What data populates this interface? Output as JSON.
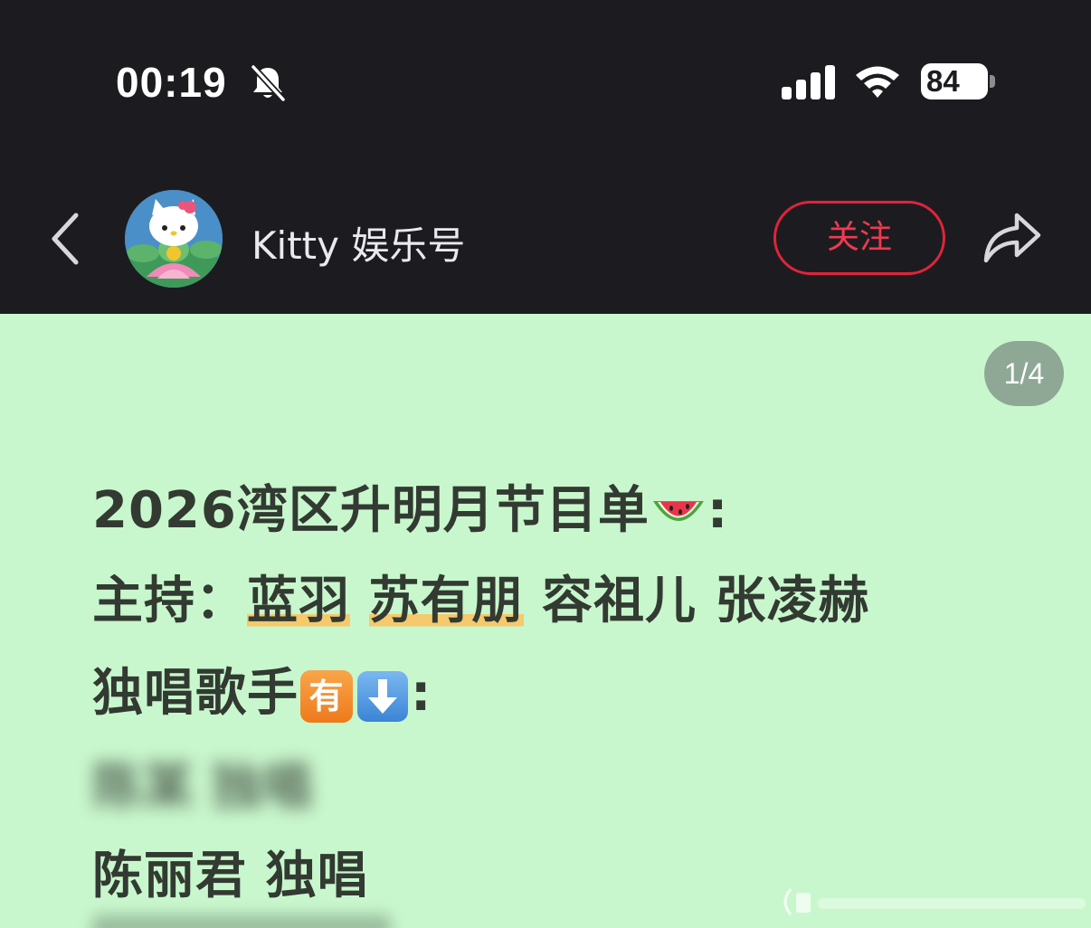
{
  "status_bar": {
    "time": "00:19",
    "battery_level": "84",
    "icons": [
      "bell-slash-icon",
      "signal-icon",
      "wifi-icon",
      "battery-charging-icon"
    ]
  },
  "nav": {
    "account_name": "Kitty 娱乐号",
    "follow_label": "关注",
    "icons": [
      "back-icon",
      "avatar",
      "share-icon"
    ]
  },
  "post": {
    "page_indicator": "1/4",
    "line1_text": "2026湾区升明月节目单",
    "line1_colon": ":",
    "line2_prefix": "主持：",
    "host_1": "蓝羽",
    "host_2": "苏有朋",
    "host_3": "容祖儿",
    "host_4": "张凌赫",
    "line3_text": "独唱歌手",
    "line3_badge": "有",
    "line3_colon": ":",
    "blurred_line": "陈某 独唱",
    "line5_text": "陈丽君 独唱"
  },
  "colors": {
    "header_bg": "#1c1c20",
    "content_bg": "#c9f7cd",
    "accent_red": "#e0243b",
    "highlight": "#f6c96c",
    "text": "#323a32"
  }
}
